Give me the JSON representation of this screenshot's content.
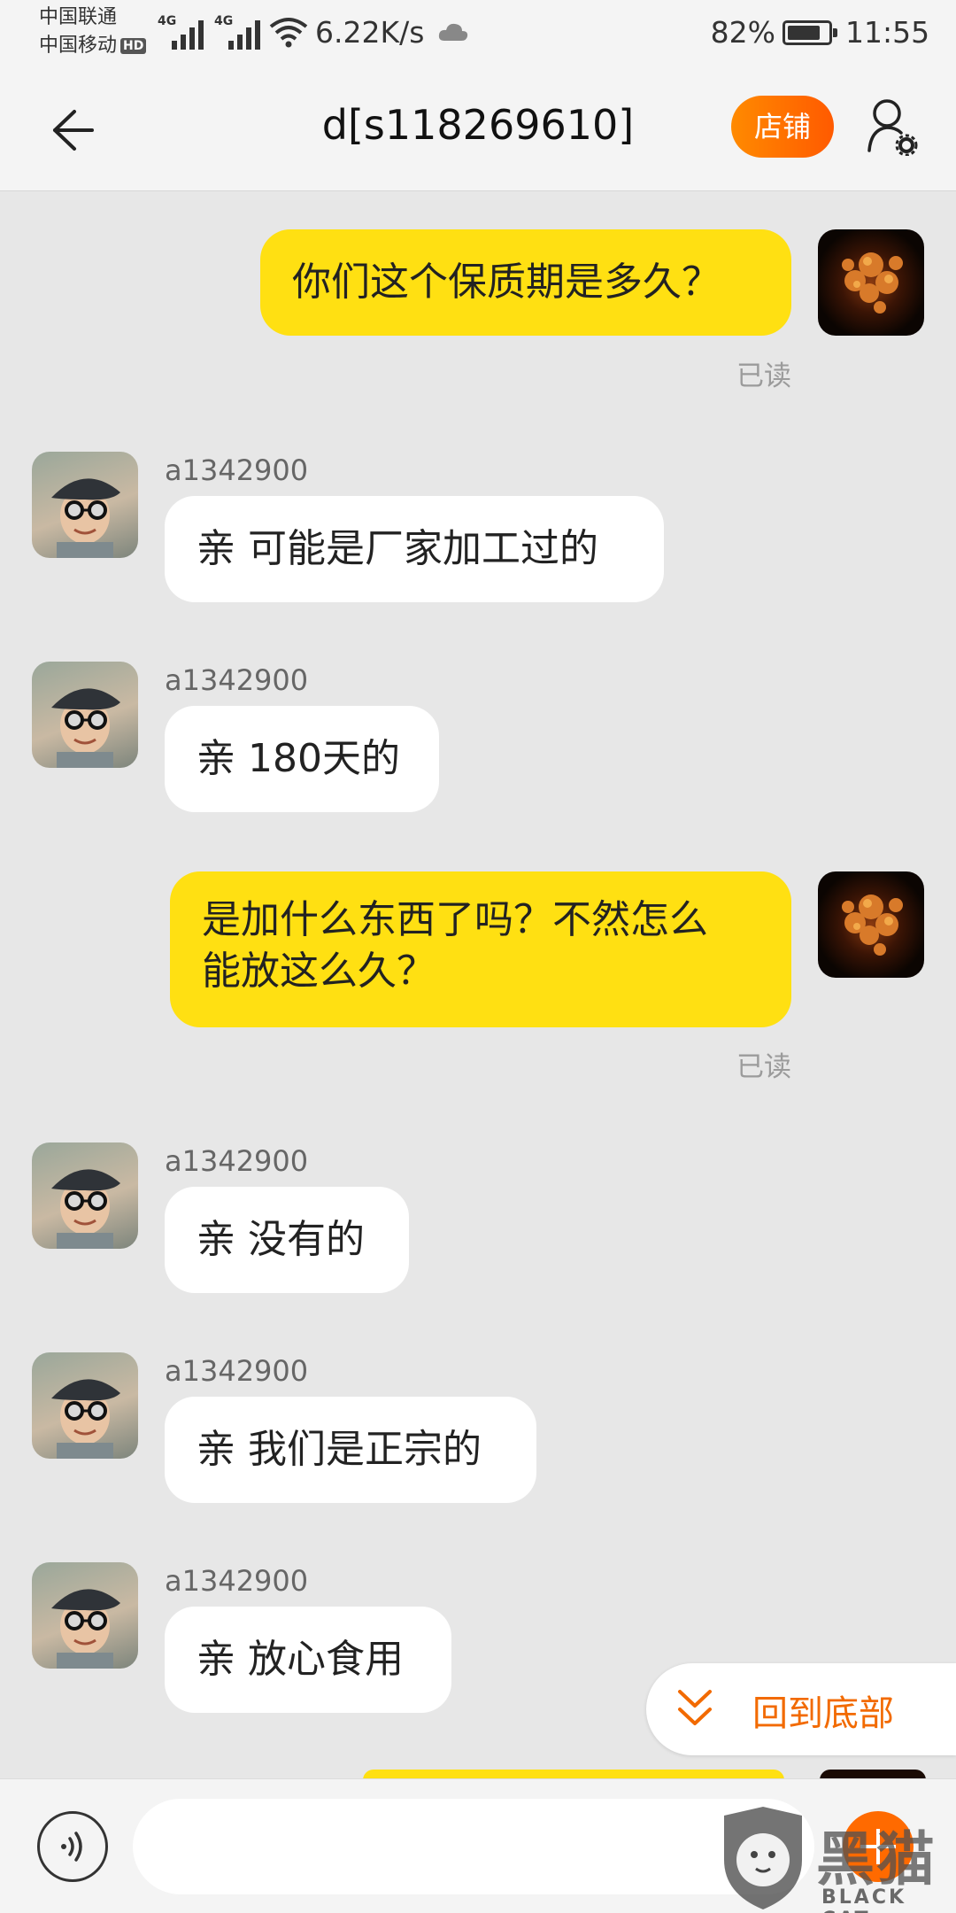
{
  "status_bar": {
    "carrier1": "中国联通",
    "carrier2": "中国移动",
    "hd_badge": "HD",
    "sim1_tag": "4G",
    "sim2_tag": "4G",
    "net_speed": "6.22K/s",
    "battery_percent": "82%",
    "battery_level": 0.82,
    "time": "11:55"
  },
  "header": {
    "title": "d[s118269610]",
    "shop_button": "店铺"
  },
  "messages": [
    {
      "from": "self",
      "text": "你们这个保质期是多久？",
      "status": "已读"
    },
    {
      "from": "shop",
      "sender": "a1342900",
      "text": "亲 可能是厂家加工过的"
    },
    {
      "from": "shop",
      "sender": "a1342900",
      "text": "亲 180天的"
    },
    {
      "from": "self",
      "text_line1": "是加什么东西了吗？不然怎么",
      "text_line2": "能放这么久？",
      "status": "已读"
    },
    {
      "from": "shop",
      "sender": "a1342900",
      "text": "亲 没有的"
    },
    {
      "from": "shop",
      "sender": "a1342900",
      "text": "亲 我们是正宗的"
    },
    {
      "from": "shop",
      "sender": "a1342900",
      "text": "亲 放心食用"
    }
  ],
  "scroll_to_bottom": "回到底部",
  "watermark": {
    "cn": "黑猫",
    "en": "BLACK CAT"
  },
  "icons": {
    "back": "arrow-left-icon",
    "profile": "person-settings-icon",
    "voice": "voice-icon",
    "more": "plus-icon",
    "chevron": "double-chevron-down-icon"
  },
  "colors": {
    "outgoing_bubble": "#ffe012",
    "incoming_bubble": "#ffffff",
    "accent_orange": "#ff6a00",
    "background": "#e7e7e7"
  }
}
